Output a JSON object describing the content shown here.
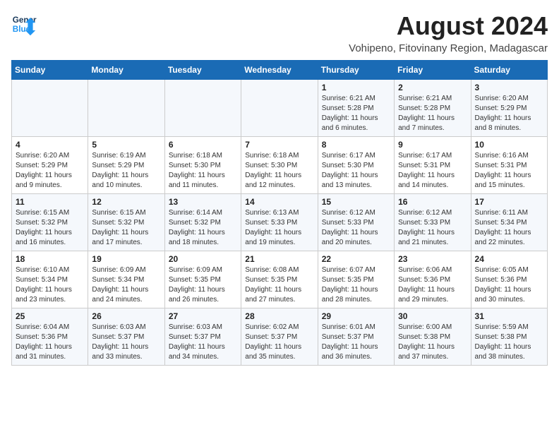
{
  "header": {
    "logo_line1": "General",
    "logo_line2": "Blue",
    "main_title": "August 2024",
    "subtitle": "Vohipeno, Fitovinany Region, Madagascar"
  },
  "weekdays": [
    "Sunday",
    "Monday",
    "Tuesday",
    "Wednesday",
    "Thursday",
    "Friday",
    "Saturday"
  ],
  "weeks": [
    [
      {
        "day": "",
        "info": ""
      },
      {
        "day": "",
        "info": ""
      },
      {
        "day": "",
        "info": ""
      },
      {
        "day": "",
        "info": ""
      },
      {
        "day": "1",
        "info": "Sunrise: 6:21 AM\nSunset: 5:28 PM\nDaylight: 11 hours and 6 minutes."
      },
      {
        "day": "2",
        "info": "Sunrise: 6:21 AM\nSunset: 5:28 PM\nDaylight: 11 hours and 7 minutes."
      },
      {
        "day": "3",
        "info": "Sunrise: 6:20 AM\nSunset: 5:29 PM\nDaylight: 11 hours and 8 minutes."
      }
    ],
    [
      {
        "day": "4",
        "info": "Sunrise: 6:20 AM\nSunset: 5:29 PM\nDaylight: 11 hours and 9 minutes."
      },
      {
        "day": "5",
        "info": "Sunrise: 6:19 AM\nSunset: 5:29 PM\nDaylight: 11 hours and 10 minutes."
      },
      {
        "day": "6",
        "info": "Sunrise: 6:18 AM\nSunset: 5:30 PM\nDaylight: 11 hours and 11 minutes."
      },
      {
        "day": "7",
        "info": "Sunrise: 6:18 AM\nSunset: 5:30 PM\nDaylight: 11 hours and 12 minutes."
      },
      {
        "day": "8",
        "info": "Sunrise: 6:17 AM\nSunset: 5:30 PM\nDaylight: 11 hours and 13 minutes."
      },
      {
        "day": "9",
        "info": "Sunrise: 6:17 AM\nSunset: 5:31 PM\nDaylight: 11 hours and 14 minutes."
      },
      {
        "day": "10",
        "info": "Sunrise: 6:16 AM\nSunset: 5:31 PM\nDaylight: 11 hours and 15 minutes."
      }
    ],
    [
      {
        "day": "11",
        "info": "Sunrise: 6:15 AM\nSunset: 5:32 PM\nDaylight: 11 hours and 16 minutes."
      },
      {
        "day": "12",
        "info": "Sunrise: 6:15 AM\nSunset: 5:32 PM\nDaylight: 11 hours and 17 minutes."
      },
      {
        "day": "13",
        "info": "Sunrise: 6:14 AM\nSunset: 5:32 PM\nDaylight: 11 hours and 18 minutes."
      },
      {
        "day": "14",
        "info": "Sunrise: 6:13 AM\nSunset: 5:33 PM\nDaylight: 11 hours and 19 minutes."
      },
      {
        "day": "15",
        "info": "Sunrise: 6:12 AM\nSunset: 5:33 PM\nDaylight: 11 hours and 20 minutes."
      },
      {
        "day": "16",
        "info": "Sunrise: 6:12 AM\nSunset: 5:33 PM\nDaylight: 11 hours and 21 minutes."
      },
      {
        "day": "17",
        "info": "Sunrise: 6:11 AM\nSunset: 5:34 PM\nDaylight: 11 hours and 22 minutes."
      }
    ],
    [
      {
        "day": "18",
        "info": "Sunrise: 6:10 AM\nSunset: 5:34 PM\nDaylight: 11 hours and 23 minutes."
      },
      {
        "day": "19",
        "info": "Sunrise: 6:09 AM\nSunset: 5:34 PM\nDaylight: 11 hours and 24 minutes."
      },
      {
        "day": "20",
        "info": "Sunrise: 6:09 AM\nSunset: 5:35 PM\nDaylight: 11 hours and 26 minutes."
      },
      {
        "day": "21",
        "info": "Sunrise: 6:08 AM\nSunset: 5:35 PM\nDaylight: 11 hours and 27 minutes."
      },
      {
        "day": "22",
        "info": "Sunrise: 6:07 AM\nSunset: 5:35 PM\nDaylight: 11 hours and 28 minutes."
      },
      {
        "day": "23",
        "info": "Sunrise: 6:06 AM\nSunset: 5:36 PM\nDaylight: 11 hours and 29 minutes."
      },
      {
        "day": "24",
        "info": "Sunrise: 6:05 AM\nSunset: 5:36 PM\nDaylight: 11 hours and 30 minutes."
      }
    ],
    [
      {
        "day": "25",
        "info": "Sunrise: 6:04 AM\nSunset: 5:36 PM\nDaylight: 11 hours and 31 minutes."
      },
      {
        "day": "26",
        "info": "Sunrise: 6:03 AM\nSunset: 5:37 PM\nDaylight: 11 hours and 33 minutes."
      },
      {
        "day": "27",
        "info": "Sunrise: 6:03 AM\nSunset: 5:37 PM\nDaylight: 11 hours and 34 minutes."
      },
      {
        "day": "28",
        "info": "Sunrise: 6:02 AM\nSunset: 5:37 PM\nDaylight: 11 hours and 35 minutes."
      },
      {
        "day": "29",
        "info": "Sunrise: 6:01 AM\nSunset: 5:37 PM\nDaylight: 11 hours and 36 minutes."
      },
      {
        "day": "30",
        "info": "Sunrise: 6:00 AM\nSunset: 5:38 PM\nDaylight: 11 hours and 37 minutes."
      },
      {
        "day": "31",
        "info": "Sunrise: 5:59 AM\nSunset: 5:38 PM\nDaylight: 11 hours and 38 minutes."
      }
    ]
  ]
}
